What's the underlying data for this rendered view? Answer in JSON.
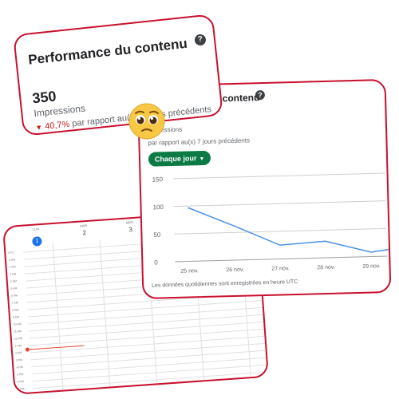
{
  "summary_card": {
    "title": "Performance du contenu",
    "help_icon": "?",
    "value": "350",
    "metric": "Impressions",
    "change_arrow": "▼",
    "change_pct": "40,7%",
    "compare_text": "par rapport au(x) 7 jours précédents"
  },
  "chart_card": {
    "title": "Performance du contenu",
    "help_icon": "?",
    "metric": "Impressions",
    "compare_text": "par rapport au(x) 7 jours précédents",
    "frequency_button": "Chaque jour",
    "footnote": "Les données quotidiennes sont enregistrées en heure UTC"
  },
  "chart_data": {
    "type": "line",
    "categories": [
      "25 nov.",
      "26 nov.",
      "27 nov.",
      "28 nov.",
      "29 nov."
    ],
    "series": [
      {
        "name": "",
        "values": [
          97,
          62,
          25,
          30,
          8
        ]
      }
    ],
    "x_extra": 12,
    "ylim": [
      0,
      150
    ],
    "yticks": [
      0,
      50,
      100,
      150
    ],
    "grid": true,
    "color": "#4a90e2"
  },
  "calendar": {
    "days": [
      {
        "dow": "LUN.",
        "num": "1",
        "today": true
      },
      {
        "dow": "MAR.",
        "num": "2",
        "today": false
      },
      {
        "dow": "MER.",
        "num": "3",
        "today": false
      }
    ],
    "hours": [
      "UTC",
      "1 AM",
      "2 AM",
      "3 AM",
      "4 AM",
      "5 AM",
      "6 AM",
      "7 AM",
      "8 AM",
      "9 AM",
      "10 AM",
      "11 AM",
      "12 PM",
      "1 PM",
      "2 PM",
      "3 PM",
      "4 PM",
      "5 PM",
      "6 PM",
      "7 PM"
    ],
    "now_color": "#ea4335"
  },
  "colors": {
    "accent_border": "#c8102e",
    "button_green": "#0b7a45",
    "negative_red": "#c5221f",
    "today_blue": "#1a73e8"
  },
  "emoji_name": "pleading-face-emoji"
}
